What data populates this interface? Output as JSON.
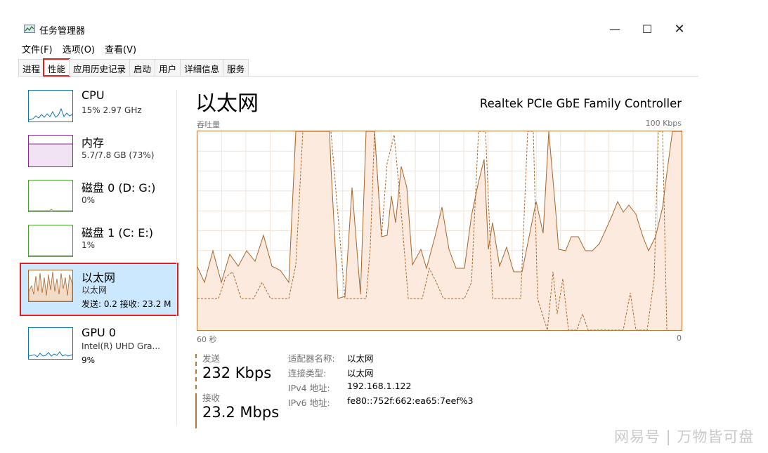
{
  "window": {
    "title": "任务管理器",
    "controls": {
      "minimize": "—",
      "maximize": "☐",
      "close": "✕"
    }
  },
  "menu": [
    "文件(F)",
    "选项(O)",
    "查看(V)"
  ],
  "tabs": [
    {
      "label": "进程",
      "active": false
    },
    {
      "label": "性能",
      "active": true
    },
    {
      "label": "应用历史记录",
      "active": false
    },
    {
      "label": "启动",
      "active": false
    },
    {
      "label": "用户",
      "active": false
    },
    {
      "label": "详细信息",
      "active": false
    },
    {
      "label": "服务",
      "active": false
    }
  ],
  "sidebar": {
    "items": [
      {
        "name": "CPU",
        "sub": "15% 2.97 GHz",
        "color": "#1176b6"
      },
      {
        "name": "内存",
        "sub": "5.7/7.8 GB (73%)",
        "color": "#8b2a9b"
      },
      {
        "name": "磁盘 0 (D: G:)",
        "sub": "0%",
        "color": "#4da22f"
      },
      {
        "name": "磁盘 1 (C: E:)",
        "sub": "1%",
        "color": "#4da22f"
      },
      {
        "name": "以太网",
        "sub": "以太网",
        "sub2": "发送: 0.2 接收: 23.2 M",
        "color": "#a7662b",
        "selected": true
      },
      {
        "name": "GPU 0",
        "sub": "Intel(R) UHD Gra...",
        "sub2": "9%",
        "color": "#1176b6"
      }
    ]
  },
  "main": {
    "title": "以太网",
    "adapter": "Realtek PCIe GbE Family Controller",
    "graph_label": "吞吐量",
    "graph_max": "100 Kbps",
    "time_left": "60 秒",
    "time_right": "0",
    "graph_color": "#a7662b",
    "send": {
      "label": "发送",
      "value": "232 Kbps"
    },
    "receive": {
      "label": "接收",
      "value": "23.2 Mbps"
    },
    "properties": [
      {
        "key": "适配器名称:",
        "value": "以太网"
      },
      {
        "key": "连接类型:",
        "value": "以太网"
      },
      {
        "key": "IPv4 地址:",
        "value": "192.168.1.122"
      },
      {
        "key": "IPv6 地址:",
        "value": "fe80::752f:662:ea65:7eef%3"
      }
    ]
  },
  "watermark": "网易号 | 万物皆可盘"
}
